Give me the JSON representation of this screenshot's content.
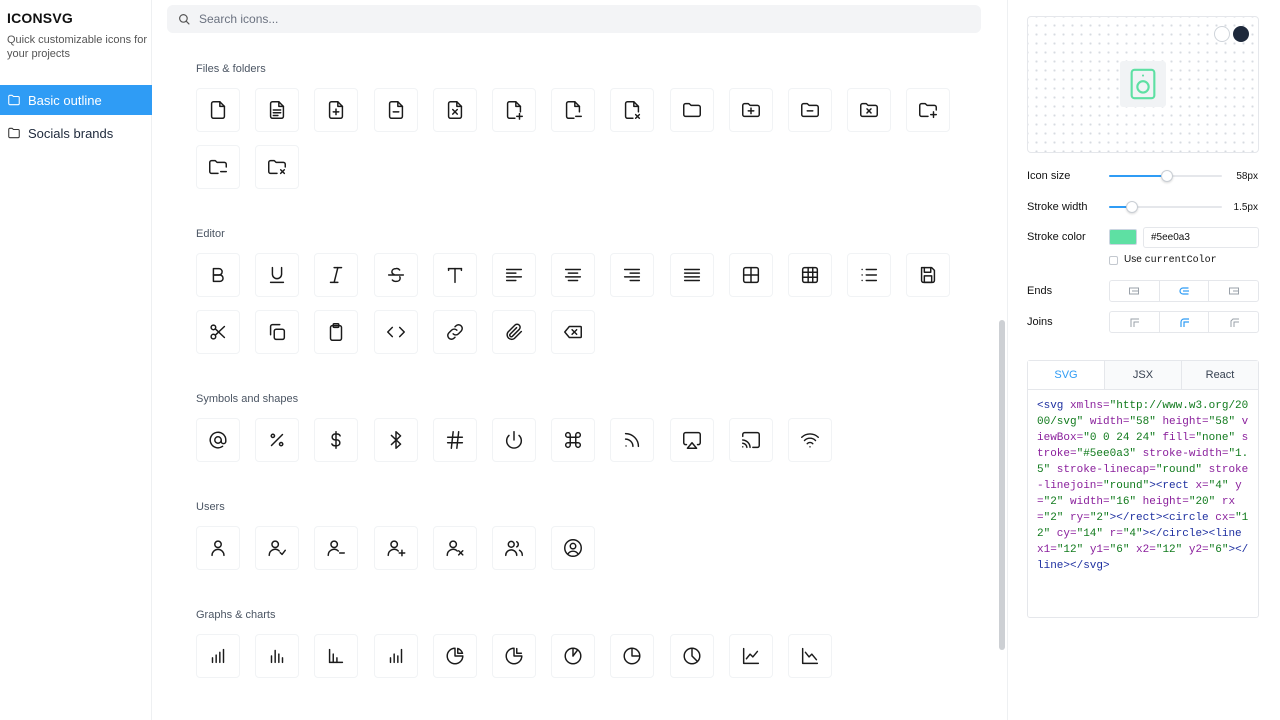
{
  "brand": {
    "title": "ICONSVG",
    "tagline": "Quick customizable icons for your projects"
  },
  "sidebar": {
    "items": [
      {
        "label": "Basic outline",
        "active": true
      },
      {
        "label": "Socials brands",
        "active": false
      }
    ]
  },
  "search": {
    "placeholder": "Search icons...",
    "value": ""
  },
  "sections": [
    {
      "title": "Files & folders",
      "icons": [
        "file",
        "file-text",
        "file-plus",
        "file-minus",
        "file-x",
        "file-export-plus",
        "file-export-minus",
        "file-export-x",
        "folder",
        "folder-plus",
        "folder-minus",
        "folder-x",
        "folder-add-corner",
        "folder-minus-corner",
        "folder-x-corner"
      ]
    },
    {
      "title": "Editor",
      "icons": [
        "bold",
        "underline",
        "italic",
        "strikethrough",
        "type",
        "align-left",
        "align-center",
        "align-right",
        "align-justify",
        "layout-grid",
        "table",
        "list",
        "save",
        "scissors",
        "copy",
        "clipboard",
        "code",
        "link",
        "paperclip",
        "backspace"
      ]
    },
    {
      "title": "Symbols and shapes",
      "icons": [
        "at-sign",
        "percent",
        "dollar",
        "bluetooth",
        "hash",
        "power",
        "command",
        "rss",
        "airplay",
        "cast",
        "wifi"
      ]
    },
    {
      "title": "Users",
      "icons": [
        "user",
        "user-check",
        "user-minus",
        "user-plus",
        "user-x",
        "users",
        "user-circle"
      ]
    },
    {
      "title": "Graphs & charts",
      "icons": [
        "bar-chart",
        "bar-chart-2",
        "bar-chart-3",
        "bar-chart-4",
        "pie-chart",
        "pie-chart-2",
        "pie-chart-3",
        "pie-chart-4",
        "pie-chart-5",
        "line-chart",
        "line-chart-down"
      ]
    }
  ],
  "panel": {
    "preview_icon": "speaker-icon",
    "stroke_color": "#5ee0a3",
    "icon_size": {
      "label": "Icon size",
      "value": "58px",
      "fraction": 0.51
    },
    "stroke_width": {
      "label": "Stroke width",
      "value": "1.5px",
      "fraction": 0.2
    },
    "stroke_color_label": "Stroke color",
    "stroke_color_value": "#5ee0a3",
    "use_current_color": {
      "label_prefix": "Use",
      "label_code": "currentColor",
      "checked": false
    },
    "ends_label": "Ends",
    "joins_label": "Joins",
    "ends_selected": 1,
    "joins_selected": 1,
    "tabs": [
      {
        "label": "SVG",
        "active": true
      },
      {
        "label": "JSX",
        "active": false
      },
      {
        "label": "React",
        "active": false
      }
    ],
    "code": [
      [
        "tg",
        "<svg"
      ],
      [
        "at",
        " xmlns="
      ],
      [
        "st",
        "\"http://www.w3.org/2000/svg\""
      ],
      [
        "at",
        " width="
      ],
      [
        "st",
        "\"58\""
      ],
      [
        "at",
        " height="
      ],
      [
        "st",
        "\"58\""
      ],
      [
        "at",
        " viewBox="
      ],
      [
        "st",
        "\"0 0 24 24\""
      ],
      [
        "at",
        " fill="
      ],
      [
        "st",
        "\"none\""
      ],
      [
        "at",
        " stroke="
      ],
      [
        "st",
        "\"#5ee0a3\""
      ],
      [
        "at",
        " stroke-width="
      ],
      [
        "st",
        "\"1.5\""
      ],
      [
        "at",
        " stroke-linecap="
      ],
      [
        "st",
        "\"round\""
      ],
      [
        "at",
        " stroke-linejoin="
      ],
      [
        "st",
        "\"round\""
      ],
      [
        "tg",
        "><rect"
      ],
      [
        "at",
        " x="
      ],
      [
        "st",
        "\"4\""
      ],
      [
        "at",
        " y="
      ],
      [
        "st",
        "\"2\""
      ],
      [
        "at",
        " width="
      ],
      [
        "st",
        "\"16\""
      ],
      [
        "at",
        " height="
      ],
      [
        "st",
        "\"20\""
      ],
      [
        "at",
        " rx="
      ],
      [
        "st",
        "\"2\""
      ],
      [
        "at",
        " ry="
      ],
      [
        "st",
        "\"2\""
      ],
      [
        "tg",
        "></rect><circle"
      ],
      [
        "at",
        " cx="
      ],
      [
        "st",
        "\"12\""
      ],
      [
        "at",
        " cy="
      ],
      [
        "st",
        "\"14\""
      ],
      [
        "at",
        " r="
      ],
      [
        "st",
        "\"4\""
      ],
      [
        "tg",
        "></circle><line"
      ],
      [
        "at",
        " x1="
      ],
      [
        "st",
        "\"12\""
      ],
      [
        "at",
        " y1="
      ],
      [
        "st",
        "\"6\""
      ],
      [
        "at",
        " x2="
      ],
      [
        "st",
        "\"12\""
      ],
      [
        "at",
        " y2="
      ],
      [
        "st",
        "\"6\""
      ],
      [
        "tg",
        "></line></svg>"
      ]
    ]
  },
  "colors": {
    "accent": "#2f9cf5",
    "dark": "#1e293b"
  }
}
